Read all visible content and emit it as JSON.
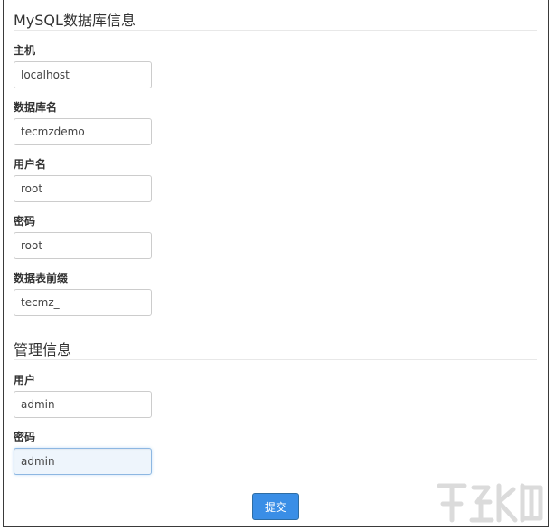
{
  "db_section": {
    "title": "MySQL数据库信息",
    "fields": [
      {
        "label": "主机",
        "value": "localhost"
      },
      {
        "label": "数据库名",
        "value": "tecmzdemo"
      },
      {
        "label": "用户名",
        "value": "root"
      },
      {
        "label": "密码",
        "value": "root"
      },
      {
        "label": "数据表前缀",
        "value": "tecmz_"
      }
    ]
  },
  "admin_section": {
    "title": "管理信息",
    "fields": [
      {
        "label": "用户",
        "value": "admin"
      },
      {
        "label": "密码",
        "value": "admin"
      }
    ]
  },
  "submit_label": "提交",
  "colors": {
    "accent": "#3a8ee6",
    "input_border": "#cccccc",
    "focus_border": "#8db7e2",
    "focus_bg": "#eef5fc"
  },
  "watermark": {
    "icon": "site-logo-watermark"
  }
}
